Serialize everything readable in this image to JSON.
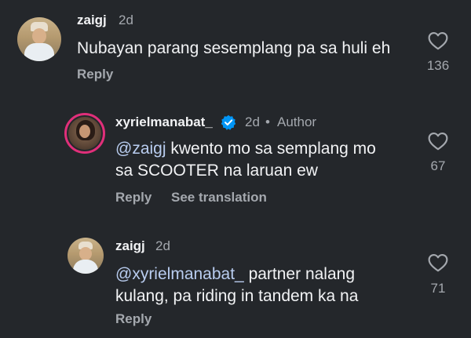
{
  "comments": [
    {
      "username": "zaigj",
      "time": "2d",
      "text": "Nubayan parang sesemplang pa sa huli eh",
      "reply_label": "Reply",
      "likes": "136"
    },
    {
      "username": "xyrielmanabat_",
      "time": "2d",
      "author_sep": "•",
      "author_label": "Author",
      "mention": "@zaigj",
      "text_line1_rest": " kwento mo sa semplang mo",
      "text_line2": "sa SCOOTER na laruan ew",
      "reply_label": "Reply",
      "translate_label": "See translation",
      "likes": "67"
    },
    {
      "username": "zaigj",
      "time": "2d",
      "mention": "@xyrielmanabat_",
      "text_line1_rest": " partner nalang",
      "text_line2": "kulang, pa riding in tandem ka na",
      "reply_label": "Reply",
      "likes": "71"
    }
  ],
  "colors": {
    "background": "#24272b",
    "mention": "#b9cdf0",
    "verified": "#0095f6",
    "story_ring": "#e02f7a"
  },
  "icons": [
    "heart-icon",
    "verified-badge-icon"
  ]
}
